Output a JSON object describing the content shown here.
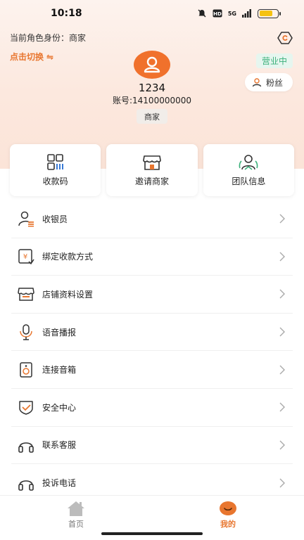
{
  "status_bar": {
    "time": "10:18",
    "network": "5G"
  },
  "header": {
    "role_prefix": "当前角色身份：",
    "role_value": "商家",
    "switch_label": "点击切换",
    "switch_arrow": "⇋",
    "business_status": "营业中",
    "fans_label": "粉丝"
  },
  "profile": {
    "username": "1234",
    "account": "账号:14100000000",
    "role_badge": "商家"
  },
  "quick_actions": [
    {
      "label": "收款码",
      "icon": "qr-code-icon"
    },
    {
      "label": "邀请商家",
      "icon": "store-icon"
    },
    {
      "label": "团队信息",
      "icon": "team-icon"
    }
  ],
  "menu": [
    {
      "label": "收银员",
      "icon": "cashier-icon"
    },
    {
      "label": "绑定收款方式",
      "icon": "payment-bind-icon"
    },
    {
      "label": "店铺资料设置",
      "icon": "shop-settings-icon"
    },
    {
      "label": "语音播报",
      "icon": "microphone-icon"
    },
    {
      "label": "连接音箱",
      "icon": "speaker-icon"
    },
    {
      "label": "安全中心",
      "icon": "shield-icon"
    },
    {
      "label": "联系客服",
      "icon": "headset-icon"
    },
    {
      "label": "投诉电话",
      "icon": "headset-icon"
    }
  ],
  "tabbar": {
    "home_label": "首页",
    "mine_label": "我的"
  },
  "colors": {
    "accent": "#e8762f",
    "status_green": "#3bb07a",
    "battery": "#f5c211"
  },
  "battery_level": 0.75
}
